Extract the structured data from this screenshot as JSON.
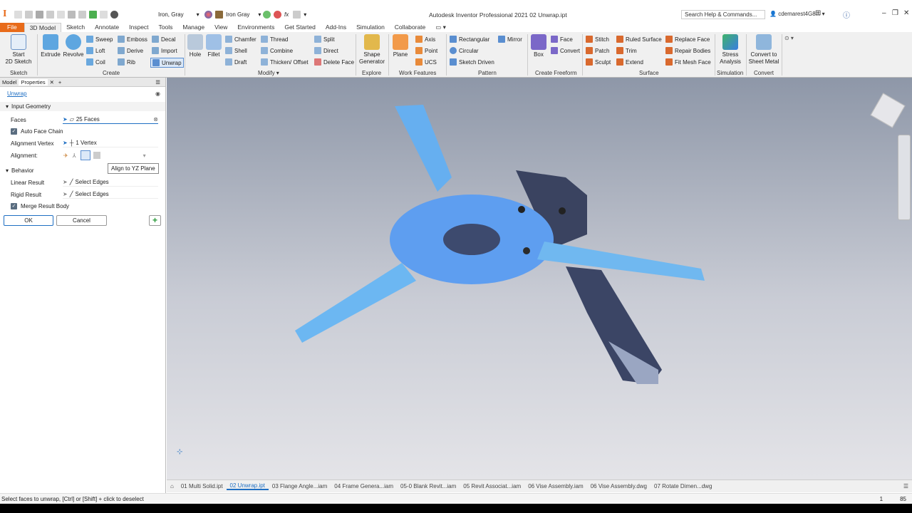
{
  "titlebar": {
    "material": "Iron, Gray",
    "appearance": "Iron Gray",
    "title": "Autodesk Inventor Professional 2021   02 Unwrap.ipt",
    "search_placeholder": "Search Help & Commands...",
    "user": "cdemarest4G8...",
    "help": "?"
  },
  "menu": {
    "tabs": [
      "File",
      "3D Model",
      "Sketch",
      "Annotate",
      "Inspect",
      "Tools",
      "Manage",
      "View",
      "Environments",
      "Get Started",
      "Add-Ins",
      "Simulation",
      "Collaborate"
    ],
    "active": "3D Model"
  },
  "ribbon": {
    "sketch": {
      "start": "Start\n2D Sketch",
      "group": "Sketch"
    },
    "create": {
      "extrude": "Extrude",
      "revolve": "Revolve",
      "sweep": "Sweep",
      "loft": "Loft",
      "coil": "Coil",
      "emboss": "Emboss",
      "derive": "Derive",
      "rib": "Rib",
      "decal": "Decal",
      "import": "Import",
      "unwrap": "Unwrap",
      "group": "Create"
    },
    "modify": {
      "hole": "Hole",
      "fillet": "Fillet",
      "chamfer": "Chamfer",
      "shell": "Shell",
      "draft": "Draft",
      "thread": "Thread",
      "combine": "Combine",
      "thicken": "Thicken/ Offset",
      "split": "Split",
      "direct": "Direct",
      "delete_face": "Delete Face",
      "group": "Modify ▾"
    },
    "explore": {
      "shape_gen": "Shape\nGenerator",
      "group": "Explore"
    },
    "work": {
      "plane": "Plane",
      "axis": "Axis",
      "point": "Point",
      "ucs": "UCS",
      "group": "Work Features"
    },
    "pattern": {
      "rect": "Rectangular",
      "circ": "Circular",
      "sketch_driven": "Sketch Driven",
      "mirror": "Mirror",
      "group": "Pattern"
    },
    "freeform": {
      "box": "Box",
      "face": "Face",
      "convert": "Convert",
      "group": "Create Freeform"
    },
    "surface": {
      "stitch": "Stitch",
      "patch": "Patch",
      "sculpt": "Sculpt",
      "ruled": "Ruled Surface",
      "trim": "Trim",
      "extend": "Extend",
      "replace": "Replace Face",
      "repair": "Repair Bodies",
      "fitmesh": "Fit Mesh Face",
      "group": "Surface"
    },
    "simulation": {
      "stress": "Stress\nAnalysis",
      "group": "Simulation"
    },
    "convert": {
      "sheet": "Convert to\nSheet Metal",
      "group": "Convert"
    }
  },
  "panel": {
    "tabs": [
      "Model",
      "Properties"
    ],
    "command": "Unwrap",
    "input_geometry": "Input Geometry",
    "faces_label": "Faces",
    "faces_value": "25 Faces",
    "auto_face_chain": "Auto Face Chain",
    "align_vertex_label": "Alignment Vertex",
    "align_vertex_value": "1 Vertex",
    "alignment_label": "Alignment:",
    "behavior": "Behavior",
    "linear_label": "Linear Result",
    "linear_value": "Select Edges",
    "rigid_label": "Rigid Result",
    "rigid_value": "Select Edges",
    "merge": "Merge Result Body",
    "ok": "OK",
    "cancel": "Cancel",
    "tooltip": "Align to YZ Plane"
  },
  "doctabs": [
    "01 Multi Solid.ipt",
    "02 Unwrap.ipt",
    "03 Flange Angle...iam",
    "04 Frame Genera...iam",
    "05-0 Blank Revit...iam",
    "05 Revit Associat...iam",
    "06 Vise Assembly.iam",
    "06 Vise Assembly.dwg",
    "07 Rotate Dimen...dwg"
  ],
  "status": {
    "text": "Select faces to unwrap, [Ctrl] or [Shift] + click to deselect",
    "n1": "1",
    "n2": "85"
  }
}
